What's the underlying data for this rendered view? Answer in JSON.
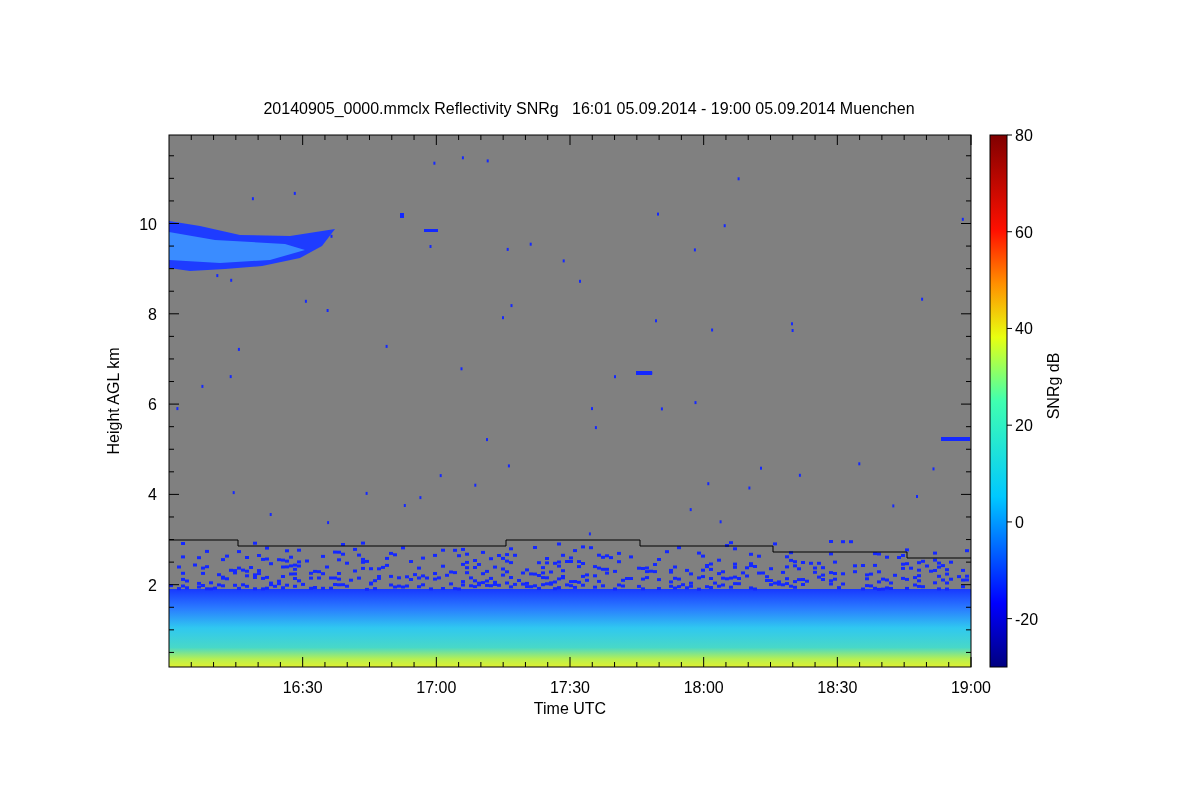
{
  "title": "20140905_0000.mmclx Reflectivity SNRg   16:01 05.09.2014 - 19:00 05.09.2014 Muenchen",
  "y_axis": {
    "label": "Height AGL km",
    "ticks": [
      "10",
      "8",
      "6",
      "4",
      "2"
    ]
  },
  "x_axis": {
    "label": "Time UTC",
    "ticks": [
      "16:30",
      "17:00",
      "17:30",
      "18:00",
      "18:30",
      "19:00"
    ]
  },
  "colorbar": {
    "label": "SNRg dB",
    "ticks": [
      "80",
      "60",
      "40",
      "20",
      "0",
      "-20"
    ]
  }
}
